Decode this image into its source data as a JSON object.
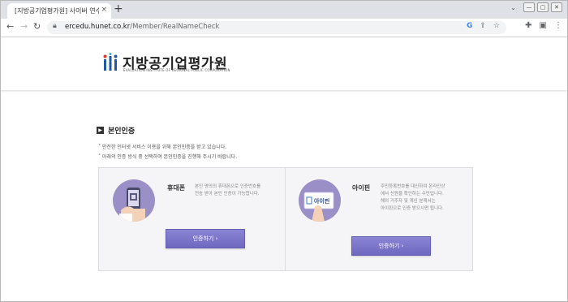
{
  "browser": {
    "tab_title": "[지방공기업평가원] 사이버 연수",
    "tab_close": "×",
    "new_tab": "+",
    "url_host": "ercedu.hunet.co.kr",
    "url_path": "/Member/RealNameCheck",
    "window_buttons": [
      "—",
      "▢",
      "✕"
    ]
  },
  "header": {
    "org_name": "지방공기업평가원",
    "org_subtitle": "EVALUATION INSTITUTE OF REGIONAL PUBLIC CORPORATION"
  },
  "section": {
    "title": "본인인증",
    "notice_1": "˚ 안전한 인터넷 서비스 이용을 위해 본인인증을 받고 있습니다.",
    "notice_2": "˚ 아래의 인증 방식 중 선택하여 본인인증을 진행해 주시기 바랍니다."
  },
  "options": [
    {
      "label": "휴대폰",
      "description_1": "본인 명의의 휴대폰으로 인증번호를",
      "description_2": "전송 받아 본인 인증이 가능합니다.",
      "button": "인증하기  ›"
    },
    {
      "label": "아이핀",
      "description_1": "주민등록번호를 대신하여 온라인상",
      "description_2": "에서 신원을 확인하는 수단입니다.",
      "description_3": "해외 거주자 및 계신 분께서는",
      "description_4": "아이핀으로 인증 받으시면 됩니다.",
      "button": "인증하기  ›",
      "card_text": "아이핀"
    }
  ],
  "colors": {
    "accent": "#7a73cc",
    "circle": "#9b8fc7",
    "logo_blue": "#1e5aa8"
  }
}
